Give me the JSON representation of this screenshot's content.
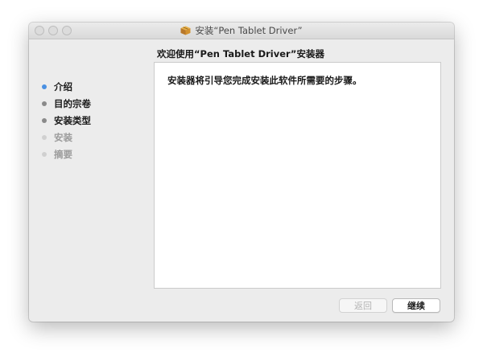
{
  "window": {
    "title": "安装“Pen Tablet Driver”",
    "title_icon": "package-icon"
  },
  "heading": "欢迎使用“Pen Tablet Driver”安装器",
  "sidebar": {
    "steps": [
      {
        "label": "介绍",
        "state": "active"
      },
      {
        "label": "目的宗卷",
        "state": "done"
      },
      {
        "label": "安装类型",
        "state": "done"
      },
      {
        "label": "安装",
        "state": "pending"
      },
      {
        "label": "摘要",
        "state": "pending"
      }
    ]
  },
  "content": {
    "text": "安装器将引导您完成安装此软件所需要的步骤。"
  },
  "buttons": {
    "back_label": "返回",
    "back_enabled": false,
    "continue_label": "继续"
  },
  "colors": {
    "active_step": "#4a90e2",
    "done_step": "#8a8a8a",
    "pending_step": "#d0d0d0",
    "window_bg": "#ececec"
  }
}
